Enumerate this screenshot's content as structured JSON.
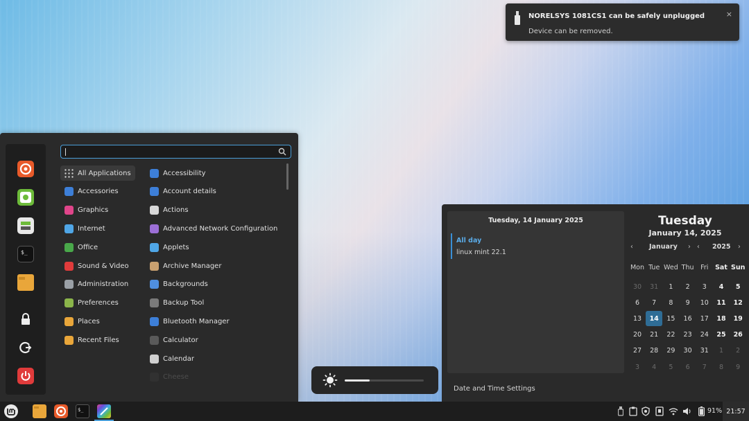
{
  "notification": {
    "title": "NORELSYS 1081CS1 can be safely unplugged",
    "body": "Device can be removed.",
    "close": "×"
  },
  "menu": {
    "search_value": "",
    "favorites": [
      "firefox-icon",
      "mint-update-icon",
      "software-manager-icon",
      "terminal-icon",
      "files-icon"
    ],
    "session": [
      "lock-icon",
      "logout-icon",
      "power-icon"
    ],
    "categories": [
      {
        "label": "All Applications",
        "icon": "grid-icon",
        "color": "#cfcfcf"
      },
      {
        "label": "Accessories",
        "icon": "accessories-icon",
        "color": "#3d7fd8"
      },
      {
        "label": "Graphics",
        "icon": "graphics-icon",
        "color": "#e0458a"
      },
      {
        "label": "Internet",
        "icon": "internet-icon",
        "color": "#4fa6e6"
      },
      {
        "label": "Office",
        "icon": "office-icon",
        "color": "#49a84a"
      },
      {
        "label": "Sound & Video",
        "icon": "sound-video-icon",
        "color": "#e03b3b"
      },
      {
        "label": "Administration",
        "icon": "administration-icon",
        "color": "#9aa0a6"
      },
      {
        "label": "Preferences",
        "icon": "preferences-icon",
        "color": "#8bb54a"
      },
      {
        "label": "Places",
        "icon": "places-icon",
        "color": "#e9a63a"
      },
      {
        "label": "Recent Files",
        "icon": "recent-files-icon",
        "color": "#e9a63a"
      }
    ],
    "apps": [
      {
        "label": "Accessibility",
        "icon": "accessibility-icon",
        "color": "#3d7fd8"
      },
      {
        "label": "Account details",
        "icon": "account-details-icon",
        "color": "#3d7fd8"
      },
      {
        "label": "Actions",
        "icon": "actions-icon",
        "color": "#d8d8d8"
      },
      {
        "label": "Advanced Network Configuration",
        "icon": "network-config-icon",
        "color": "#9c6fd6"
      },
      {
        "label": "Applets",
        "icon": "applets-icon",
        "color": "#4fa6e6"
      },
      {
        "label": "Archive Manager",
        "icon": "archive-manager-icon",
        "color": "#c8a070"
      },
      {
        "label": "Backgrounds",
        "icon": "backgrounds-icon",
        "color": "#4f8fe0"
      },
      {
        "label": "Backup Tool",
        "icon": "backup-tool-icon",
        "color": "#7a7a7a"
      },
      {
        "label": "Bluetooth Manager",
        "icon": "bluetooth-icon",
        "color": "#3d7fd8"
      },
      {
        "label": "Calculator",
        "icon": "calculator-icon",
        "color": "#5a5a5a"
      },
      {
        "label": "Calendar",
        "icon": "calendar-app-icon",
        "color": "#d0d0d0"
      },
      {
        "label": "Cheese",
        "icon": "cheese-icon",
        "color": "#555555"
      }
    ]
  },
  "osd": {
    "brightness": 0.32
  },
  "calendar": {
    "events_header": "Tuesday, 14 January 2025",
    "all_day": "All day",
    "event": "linux mint 22.1",
    "settings": "Date and Time Settings",
    "day_name": "Tuesday",
    "full_date": "January 14, 2025",
    "month": "January",
    "year": "2025",
    "prev": "‹",
    "next": "›",
    "weekdays": [
      "Mon",
      "Tue",
      "Wed",
      "Thu",
      "Fri",
      "Sat",
      "Sun"
    ],
    "weeks": [
      [
        "30",
        "31",
        "1",
        "2",
        "3",
        "4",
        "5"
      ],
      [
        "6",
        "7",
        "8",
        "9",
        "10",
        "11",
        "12"
      ],
      [
        "13",
        "14",
        "15",
        "16",
        "17",
        "18",
        "19"
      ],
      [
        "20",
        "21",
        "22",
        "23",
        "24",
        "25",
        "26"
      ],
      [
        "27",
        "28",
        "29",
        "30",
        "31",
        "1",
        "2"
      ],
      [
        "3",
        "4",
        "5",
        "6",
        "7",
        "8",
        "9"
      ]
    ],
    "today": "14"
  },
  "taskbar": {
    "launchers": [
      "mint-menu-icon",
      "files-icon",
      "firefox-icon",
      "terminal-icon",
      "color-app-icon"
    ],
    "tray": [
      "usb-drive-icon",
      "clipboard-icon",
      "shield-icon",
      "notes-icon",
      "wifi-icon",
      "volume-icon",
      "battery-icon"
    ],
    "battery": "91%",
    "clock": "21:57"
  }
}
